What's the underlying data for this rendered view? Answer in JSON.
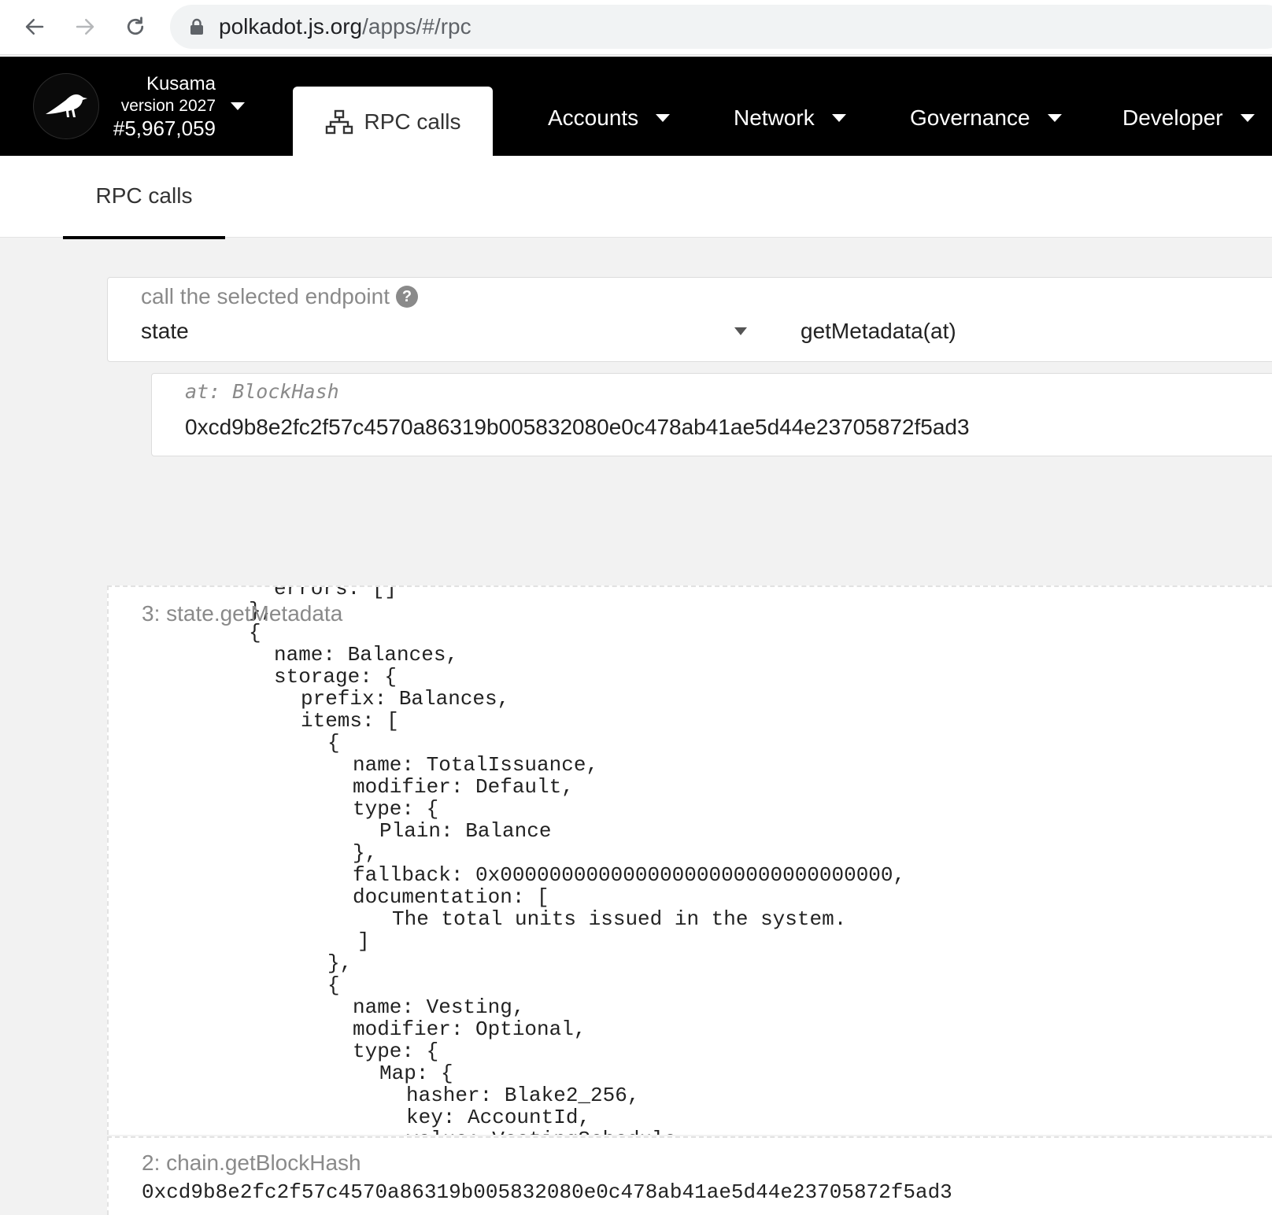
{
  "browser": {
    "back_icon": "arrow-left-icon",
    "forward_icon": "arrow-right-icon",
    "reload_icon": "reload-icon",
    "lock_icon": "lock-icon",
    "url_host": "polkadot.js.org",
    "url_path": "/apps/#/rpc"
  },
  "header": {
    "chain_name": "Kusama",
    "chain_version": "version 2027",
    "block_number": "#5,967,059",
    "active_tab_label": "RPC calls",
    "menu": [
      {
        "label": "Accounts"
      },
      {
        "label": "Network"
      },
      {
        "label": "Governance"
      },
      {
        "label": "Developer"
      }
    ],
    "colors": {
      "background": "#000000",
      "text": "#ffffff"
    }
  },
  "subnav": {
    "tab_label": "RPC calls"
  },
  "endpoint": {
    "label": "call the selected endpoint",
    "help_glyph": "?",
    "section": "state",
    "method": "getMetadata(at)"
  },
  "param": {
    "label": "at: BlockHash",
    "value": "0xcd9b8e2fc2f57c4570a86319b005832080e0c478ab41ae5d44e23705872f5ad3"
  },
  "outputs": [
    {
      "title": "3: state.getMetadata",
      "lines": [
        "errors: []",
        "},",
        "{",
        "name: Balances,",
        "storage: {",
        "prefix: Balances,",
        "items: [",
        "{",
        "name: TotalIssuance,",
        "modifier: Default,",
        "type: {",
        "Plain: Balance",
        "},",
        "fallback: 0x00000000000000000000000000000000,",
        "documentation: [",
        "The total units issued in the system.",
        "]",
        "},",
        "{",
        "name: Vesting,",
        "modifier: Optional,",
        "type: {",
        "Map: {",
        "hasher: Blake2_256,",
        "key: AccountId,",
        "value: VestingSchedule,"
      ]
    },
    {
      "title": "2: chain.getBlockHash",
      "value": "0xcd9b8e2fc2f57c4570a86319b005832080e0c478ab41ae5d44e23705872f5ad3"
    }
  ]
}
